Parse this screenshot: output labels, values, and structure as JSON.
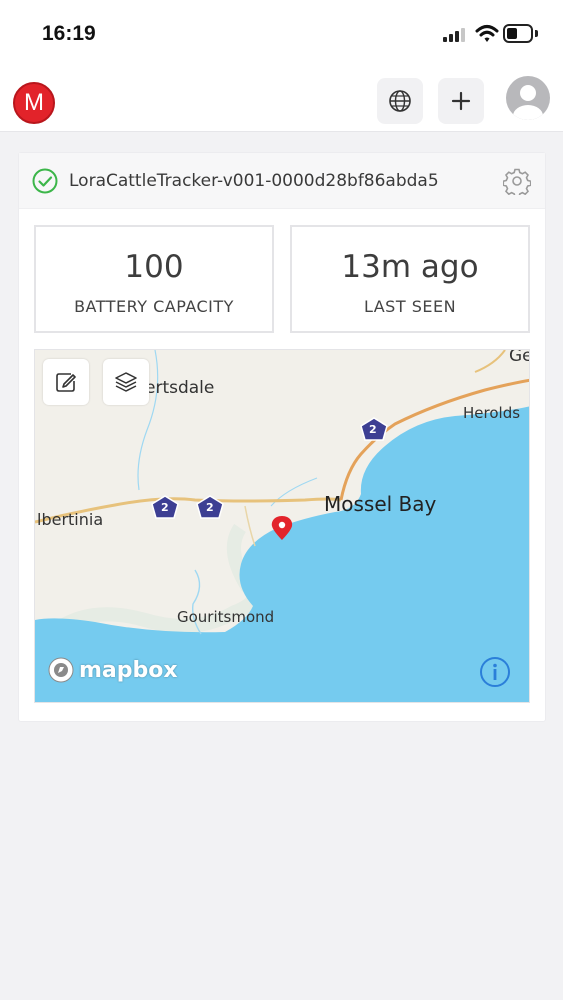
{
  "status_bar": {
    "time": "16:19"
  },
  "header": {
    "logo_letter": "M",
    "globe_icon": "globe-icon",
    "add_icon": "plus-icon",
    "avatar_icon": "user-avatar-icon"
  },
  "device": {
    "name": "LoraCattleTracker-v001-0000d28bf86abda5",
    "status_icon": "check-circle-icon",
    "settings_icon": "gear-icon",
    "status_color": "#3cb64a"
  },
  "stats": {
    "battery": {
      "value": "100",
      "label": "BATTERY CAPACITY"
    },
    "last_seen": {
      "value": "13m ago",
      "label": "LAST SEEN"
    }
  },
  "map": {
    "tools": [
      "edit-icon",
      "layers-icon"
    ],
    "places": {
      "ge": "Ge",
      "riversdale": "ertsdale",
      "herolds": "Herolds",
      "mossel_bay": "Mossel Bay",
      "albertinia": "lbertinia",
      "gouritsmond": "Gouritsmond"
    },
    "route_badges": [
      "2",
      "2",
      "2"
    ],
    "attribution": "mapbox",
    "colors": {
      "sea": "#75cbef",
      "land": "#f2f0ea",
      "road": "#e4a25a",
      "marker": "#e3242b",
      "badge": "#3d3f93"
    }
  }
}
